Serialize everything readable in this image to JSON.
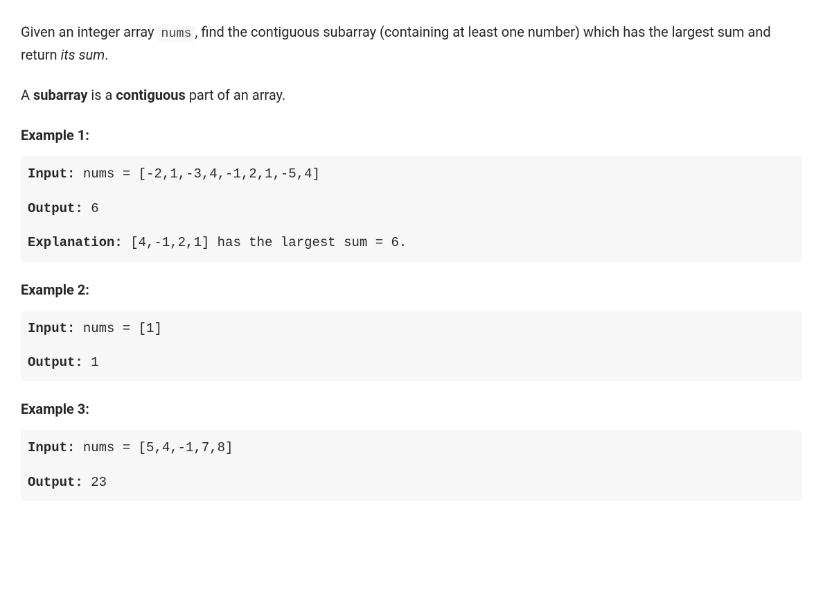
{
  "intro": {
    "pre": "Given an integer array ",
    "code": "nums",
    "mid": ", find the contiguous subarray (containing at least one number) which has the largest sum and return ",
    "ital": "its sum",
    "post": "."
  },
  "subarray": {
    "pre": "A ",
    "b1": "subarray",
    "mid": " is a ",
    "b2": "contiguous",
    "post": " part of an array."
  },
  "labels": {
    "input": "Input:",
    "output": "Output:",
    "explanation": "Explanation:"
  },
  "examples": [
    {
      "heading": "Example 1:",
      "input_text": " nums = [-2,1,-3,4,-1,2,1,-5,4]",
      "output_text": " 6",
      "explanation_text": " [4,-1,2,1] has the largest sum = 6."
    },
    {
      "heading": "Example 2:",
      "input_text": " nums = [1]",
      "output_text": " 1"
    },
    {
      "heading": "Example 3:",
      "input_text": " nums = [5,4,-1,7,8]",
      "output_text": " 23"
    }
  ]
}
